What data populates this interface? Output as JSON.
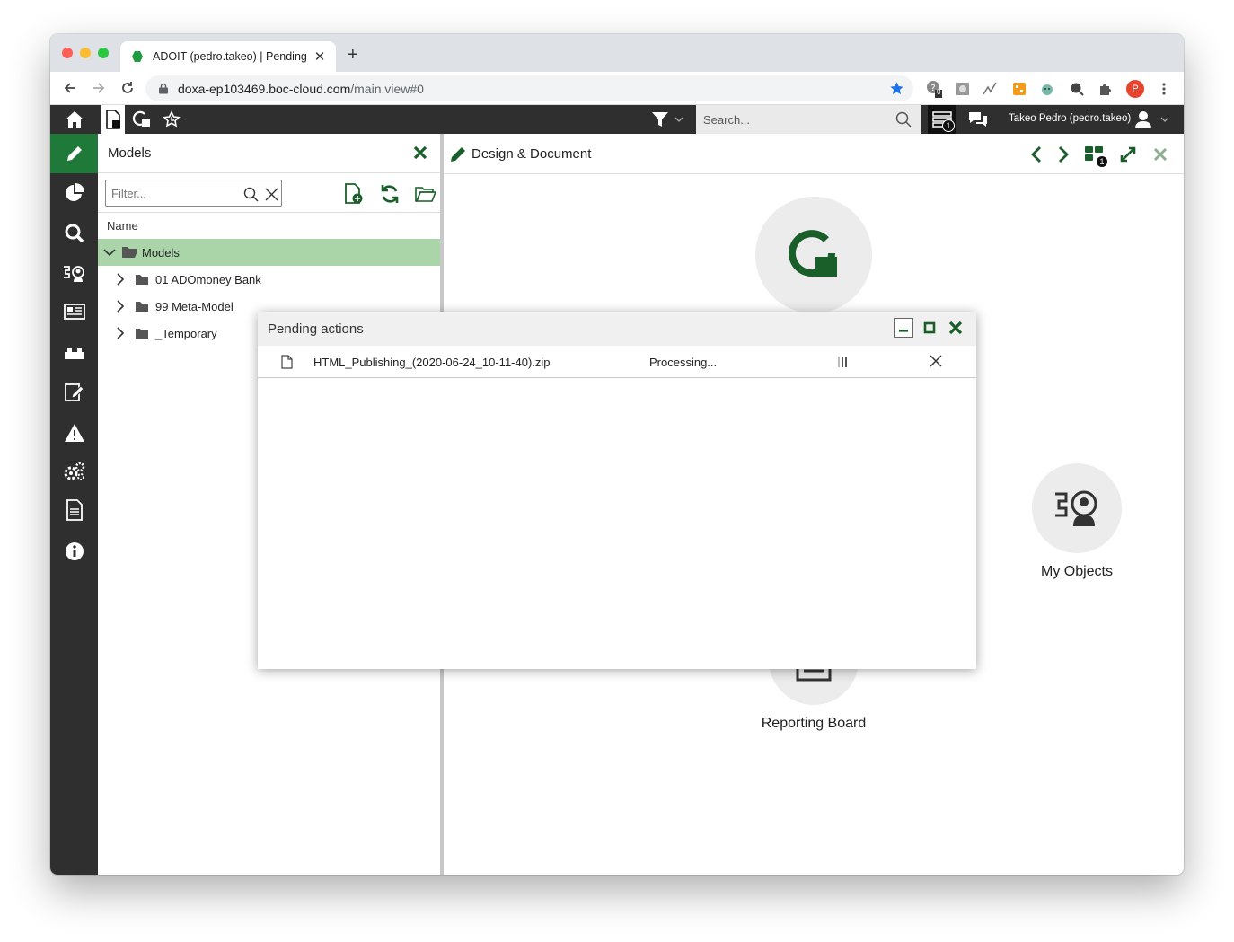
{
  "browser": {
    "tab_title": "ADOIT (pedro.takeo) | Pending",
    "url_host": "doxa-ep103469.boc-cloud.com",
    "url_path": "/main.view#0",
    "extension_badge": "0",
    "profile_initial": "P"
  },
  "header": {
    "search_placeholder": "Search...",
    "notification_count": "1",
    "user_label": "Takeo Pedro (pedro.takeo)"
  },
  "sidebar": {
    "items": [
      "pencil-icon",
      "pie-chart-icon",
      "search-icon",
      "my-objects-icon",
      "newspaper-icon",
      "blocks-icon",
      "edit-doc-icon",
      "warning-icon",
      "gears-icon",
      "document-icon",
      "info-icon"
    ]
  },
  "models_panel": {
    "title": "Models",
    "filter_placeholder": "Filter...",
    "column_name": "Name",
    "tree": [
      {
        "label": "Models",
        "expanded": true,
        "selected": true
      },
      {
        "label": "01 ADOmoney Bank",
        "expanded": false
      },
      {
        "label": "99 Meta-Model",
        "expanded": false
      },
      {
        "label": "_Temporary",
        "expanded": false
      }
    ]
  },
  "design_pane": {
    "title": "Design & Document",
    "windows_count": "1",
    "tiles": {
      "my_objects": "My Objects",
      "reporting_board": "Reporting Board"
    }
  },
  "pending_dialog": {
    "title": "Pending actions",
    "actions": [
      {
        "file": "HTML_Publishing_(2020-06-24_10-11-40).zip",
        "status": "Processing..."
      }
    ]
  },
  "colors": {
    "accent_green": "#1f7a3a",
    "selected_row": "#a9d5a9",
    "dark_bar": "#2f2f2f",
    "icon_green": "#1a5f2a"
  }
}
